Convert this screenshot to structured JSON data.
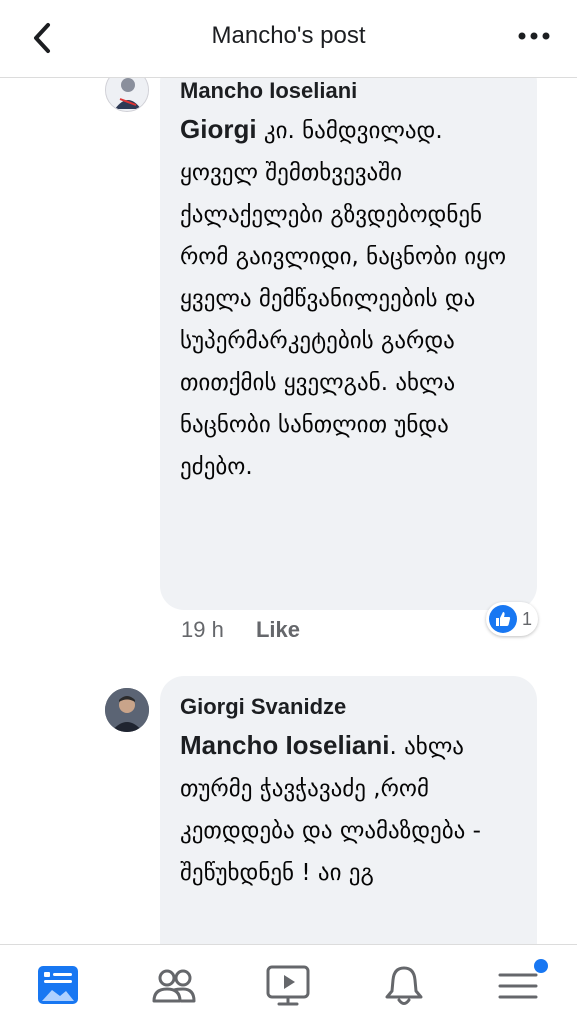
{
  "header": {
    "title": "Mancho's post",
    "back_icon": "chevron-left-icon",
    "more_icon": "more-horizontal-icon"
  },
  "comments": [
    {
      "author": "Mancho Ioseliani",
      "mention": "Giorgi",
      "text": " კი. ნამდვილად. ყოველ შემთხვევაში ქალაქელები გზვდებოდნენ რომ გაივლიდი, ნაცნობი იყო ყველა მემწვანილეების და სუპერმარკეტების გარდა თითქმის ყველგან. ახლა ნაცნობი სანთლით უნდა ეძებო.",
      "time": "19 h",
      "like_label": "Like",
      "reaction_count": "1",
      "reaction_icon": "like-reaction-icon"
    },
    {
      "author": "Giorgi Svanidze",
      "mention": "Mancho Ioseliani",
      "text": ". ახლა თურმე ჭავჭავაძე ,რომ კეთდდება და ლამაზდება - შეწუხდნენ ! აი ეგ"
    }
  ],
  "bottom_nav": {
    "items": [
      "news-feed-icon",
      "friends-icon",
      "watch-icon",
      "notifications-bell-icon",
      "menu-icon"
    ]
  },
  "colors": {
    "accent": "#1877f2",
    "bubble": "#f0f2f5",
    "secondary_text": "#65676b"
  }
}
